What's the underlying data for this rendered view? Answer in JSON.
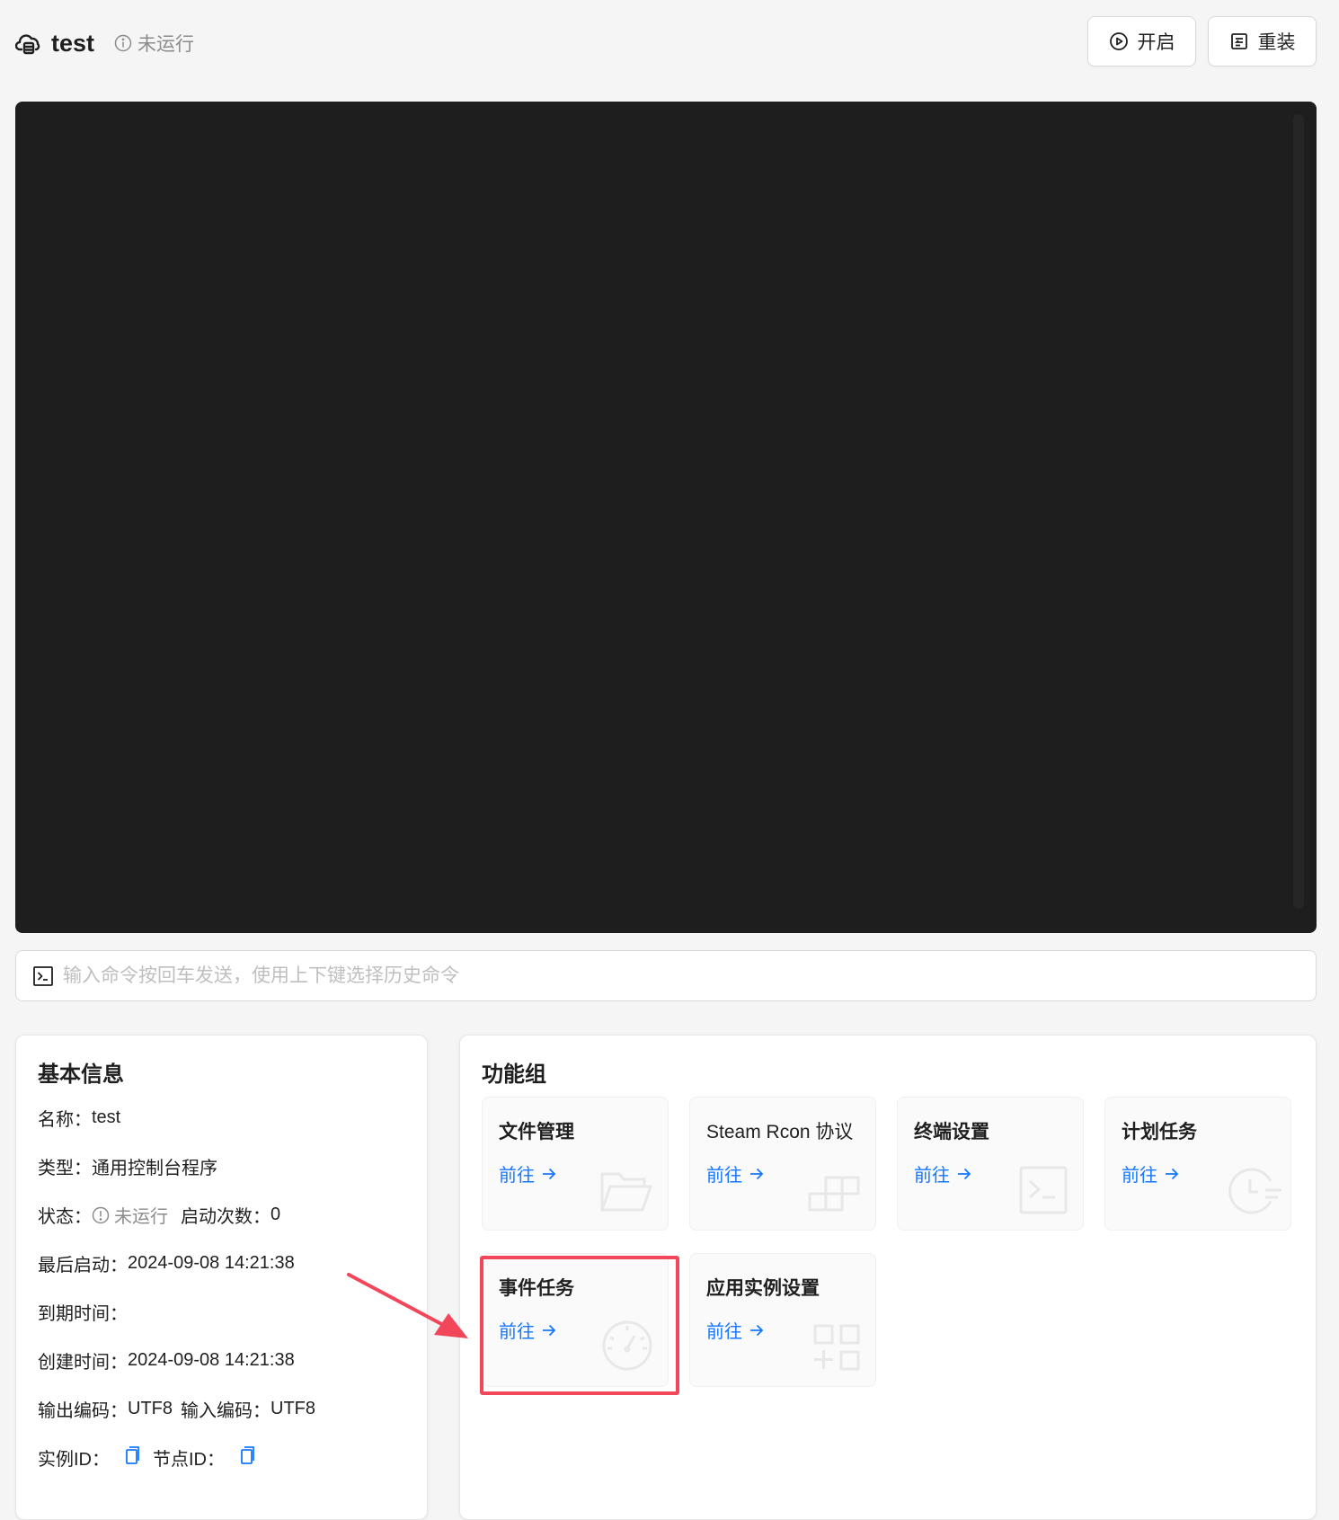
{
  "header": {
    "title": "test",
    "status": "未运行",
    "buttons": {
      "start": "开启",
      "reinstall": "重装"
    },
    "icons": {
      "title": "cloud-server-icon",
      "status": "info-circle-icon",
      "start": "play-circle-icon",
      "reinstall": "reinstall-icon"
    }
  },
  "terminal": {
    "background": "#1e1e1e"
  },
  "command": {
    "placeholder": "输入命令按回车发送，使用上下键选择历史命令",
    "value": "",
    "icon": "terminal-prompt-icon"
  },
  "info": {
    "title": "基本信息",
    "name_label": "名称：",
    "name_value": "test",
    "type_label": "类型：",
    "type_value": "通用控制台程序",
    "state_label": "状态：",
    "state_value": "未运行",
    "starts_label": "启动次数：",
    "starts_value": "0",
    "last_start_label": "最后启动：",
    "last_start_value": "2024-09-08 14:21:38",
    "expire_label": "到期时间：",
    "expire_value": "",
    "created_label": "创建时间：",
    "created_value": "2024-09-08 14:21:38",
    "output_enc_label": "输出编码：",
    "output_enc_value": "UTF8",
    "input_enc_label": "输入编码：",
    "input_enc_value": "UTF8",
    "instance_id_label": "实例ID：",
    "node_id_label": "节点ID："
  },
  "features": {
    "title": "功能组",
    "go_label": "前往",
    "items": [
      {
        "title": "文件管理",
        "icon": "folder-open-icon"
      },
      {
        "title": "Steam Rcon 协议",
        "icon": "blocks-icon"
      },
      {
        "title": "终端设置",
        "icon": "code-terminal-icon"
      },
      {
        "title": "计划任务",
        "icon": "schedule-clock-icon"
      },
      {
        "title": "事件任务",
        "icon": "dashboard-gauge-icon"
      },
      {
        "title": "应用实例设置",
        "icon": "app-grid-add-icon"
      }
    ]
  },
  "colors": {
    "accent": "#1677ff",
    "highlight": "#f2465a",
    "terminal": "#1e1e1e"
  }
}
